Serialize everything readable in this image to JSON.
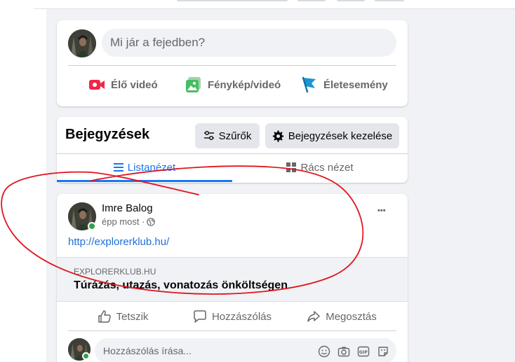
{
  "composer": {
    "placeholder": "Mi jár a fejedben?",
    "actions": [
      {
        "label": "Élő videó",
        "icon": "live-video-icon",
        "color": "#f02849"
      },
      {
        "label": "Fénykép/videó",
        "icon": "photo-icon",
        "color": "#45bd62"
      },
      {
        "label": "Életesemény",
        "icon": "life-event-flag-icon",
        "color": "#1b95d4"
      }
    ]
  },
  "posts_header": {
    "title": "Bejegyzések",
    "filters_label": "Szűrők",
    "manage_label": "Bejegyzések kezelése",
    "tabs": [
      {
        "label": "Listanézet",
        "active": true
      },
      {
        "label": "Rács nézet",
        "active": false
      }
    ]
  },
  "post": {
    "author": "Imre Balog",
    "time": "épp most ·",
    "privacy_icon": "globe-icon",
    "link": "http://explorerklub.hu/",
    "preview_domain": "EXPLORERKLUB.HU",
    "preview_title": "Túrázás, utazás, vonatozás önköltségen",
    "more_label": "•••",
    "actions": {
      "like": "Tetszik",
      "comment": "Hozzászólás",
      "share": "Megosztás"
    },
    "comment_placeholder": "Hozzászólás írása..."
  },
  "colors": {
    "accent": "#1877f2",
    "annotation": "#e0141e",
    "online": "#31a24c"
  }
}
